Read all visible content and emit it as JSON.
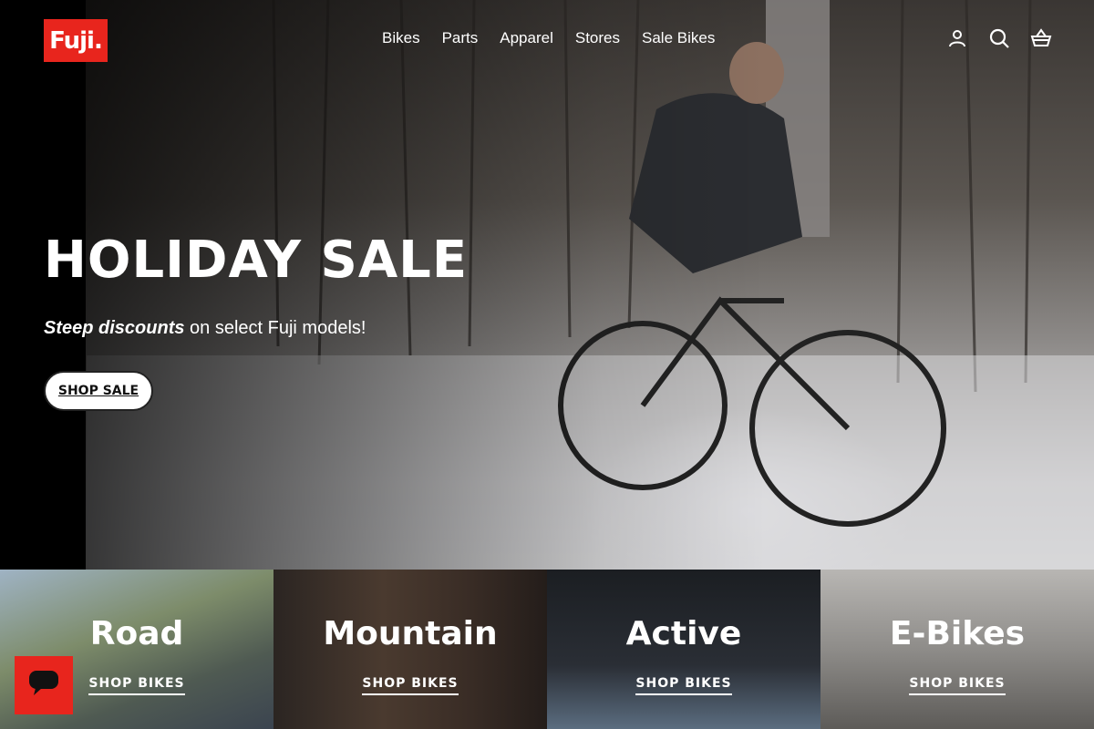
{
  "brand": {
    "logo_text": "Fuji.",
    "accent_color": "#e8251d"
  },
  "nav": {
    "items": [
      "Bikes",
      "Parts",
      "Apparel",
      "Stores",
      "Sale Bikes"
    ]
  },
  "header_icons": [
    "account-icon",
    "search-icon",
    "cart-basket-icon"
  ],
  "hero": {
    "headline": "HOLIDAY SALE",
    "sub_emphasis": "Steep discounts",
    "sub_rest": " on select Fuji models!",
    "cta_label": "SHOP SALE"
  },
  "categories": [
    {
      "title": "Road",
      "link": "SHOP BIKES"
    },
    {
      "title": "Mountain",
      "link": "SHOP BIKES"
    },
    {
      "title": "Active",
      "link": "SHOP BIKES"
    },
    {
      "title": "E-Bikes",
      "link": "SHOP BIKES"
    }
  ],
  "chat_widget": {
    "icon": "chat-icon"
  }
}
